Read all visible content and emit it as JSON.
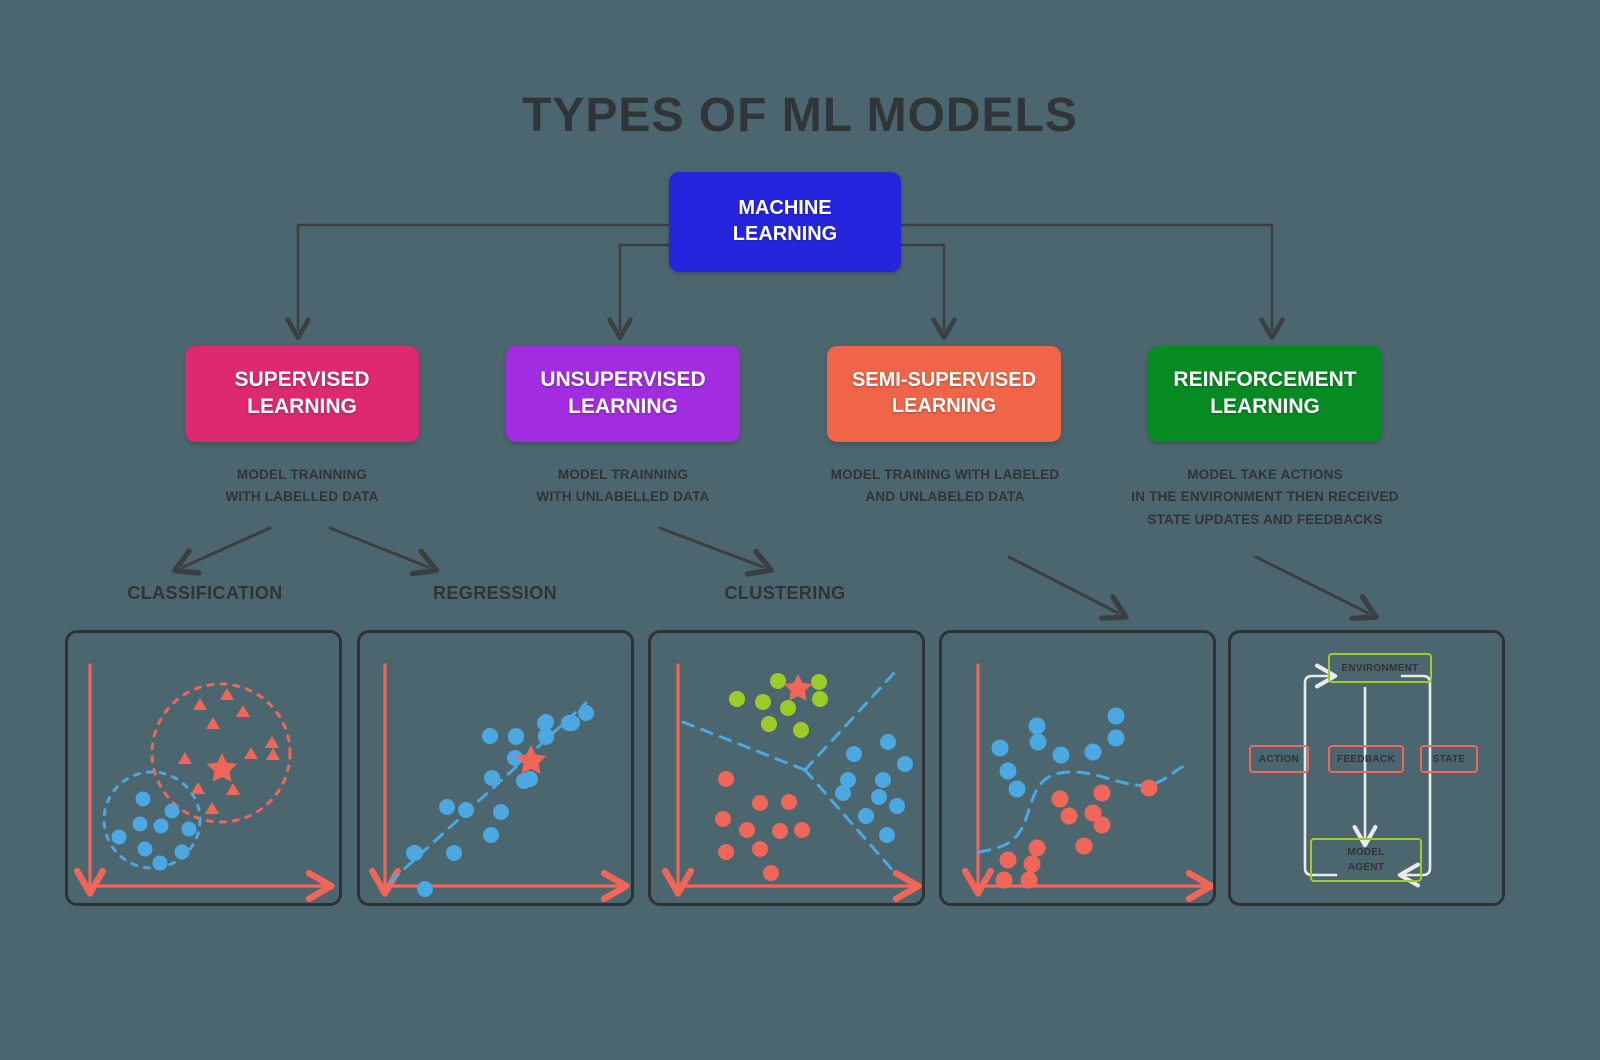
{
  "page": {
    "title": "TYPES OF ML MODELS",
    "background_color": "#4c6670",
    "text_color": "#2f3436"
  },
  "root_node": {
    "label": "MACHINE\nLEARNING",
    "line1": "MACHINE",
    "line2": "LEARNING",
    "color": "#2525dd"
  },
  "categories": [
    {
      "id": "supervised",
      "line1": "SUPERVISED",
      "line2": "LEARNING",
      "color": "#dc2970",
      "description_line1": "MODEL TRAINNING",
      "description_line2": "WITH LABELLED DATA"
    },
    {
      "id": "unsupervised",
      "line1": "UNSUPERVISED",
      "line2": "LEARNING",
      "color": "#a22ce0",
      "description_line1": "MODEL TRAINNING",
      "description_line2": "WITH UNLABELLED DATA"
    },
    {
      "id": "semi-supervised",
      "line1": "SEMI-SUPERVISED",
      "line2": "LEARNING",
      "color": "#f06548",
      "description_line1": "MODEL TRAINING WITH LABELED",
      "description_line2": "AND UNLABELED DATA"
    },
    {
      "id": "reinforcement",
      "line1": "REINFORCEMENT",
      "line2": "LEARNING",
      "color": "#068a22",
      "description_line1": "MODEL TAKE ACTIONS",
      "description_line2": "IN THE ENVIRONMENT THEN RECEIVED",
      "description_line3": "STATE UPDATES AND FEEDBACKS"
    }
  ],
  "sub_labels": {
    "classification": "CLASSIFICATION",
    "regression": "REGRESSION",
    "clustering": "CLUSTERING"
  },
  "rl_diagram": {
    "environment": "ENVIRONMENT",
    "action": "ACTION",
    "feedback": "FEEDBACK",
    "state": "STATE",
    "model_agent_line1": "MODEL",
    "model_agent_line2": "AGENT",
    "green_border": "#9ccb2a",
    "red_border": "#f0675a",
    "arrow_color": "#e8ebe9"
  },
  "palette": {
    "axis_red": "#f0675a",
    "point_blue": "#4ba8e0",
    "point_green": "#9ccb2a",
    "point_red": "#f0675a",
    "panel_border": "#2d3234",
    "connector": "#3a4042"
  },
  "chart_data": [
    {
      "id": "classification",
      "type": "scatter",
      "title": "CLASSIFICATION",
      "xlabel": "",
      "ylabel": "",
      "grid": false,
      "legend": "none",
      "xlim": [
        0,
        100
      ],
      "ylim": [
        0,
        100
      ],
      "series": [
        {
          "name": "class-a-triangles",
          "marker": "triangle",
          "color": "#f0675a",
          "points": [
            [
              57,
              78
            ],
            [
              47,
              71
            ],
            [
              61,
              68
            ],
            [
              54,
              63
            ],
            [
              72,
              64
            ],
            [
              72,
              58
            ],
            [
              78,
              61
            ],
            [
              42,
              57
            ],
            [
              48,
              45
            ],
            [
              59,
              45
            ],
            [
              52,
              38
            ],
            [
              55,
              53
            ]
          ]
        },
        {
          "name": "class-b-circles",
          "marker": "circle",
          "color": "#4ba8e0",
          "points": [
            [
              25,
              41
            ],
            [
              34,
              37
            ],
            [
              23,
              32
            ],
            [
              31,
              31
            ],
            [
              38,
              30
            ],
            [
              16,
              26
            ],
            [
              25,
              22
            ],
            [
              39,
              21
            ],
            [
              30,
              17
            ]
          ]
        },
        {
          "name": "query-point",
          "marker": "star",
          "color": "#f0675a",
          "points": [
            [
              55,
              53
            ]
          ]
        }
      ],
      "boundaries": [
        {
          "shape": "circle",
          "color": "#f0675a",
          "style": "dashed",
          "cx": 57,
          "cy": 56,
          "r": 24
        },
        {
          "shape": "circle",
          "color": "#4ba8e0",
          "style": "dashed",
          "cx": 27,
          "cy": 29,
          "r": 17
        }
      ]
    },
    {
      "id": "regression",
      "type": "scatter",
      "title": "REGRESSION",
      "xlabel": "",
      "ylabel": "",
      "grid": false,
      "legend": "none",
      "xlim": [
        0,
        100
      ],
      "ylim": [
        0,
        100
      ],
      "series": [
        {
          "name": "observations",
          "marker": "circle",
          "color": "#4ba8e0",
          "points": [
            [
              17,
              7
            ],
            [
              13,
              20
            ],
            [
              24,
              20
            ],
            [
              33,
              26
            ],
            [
              23,
              36
            ],
            [
              28,
              35
            ],
            [
              37,
              35
            ],
            [
              34,
              47
            ],
            [
              43,
              54
            ],
            [
              40,
              62
            ],
            [
              46,
              47
            ],
            [
              60,
              55
            ],
            [
              53,
              67
            ],
            [
              66,
              70
            ],
            [
              76,
              63
            ],
            [
              83,
              74
            ]
          ]
        },
        {
          "name": "prediction",
          "marker": "star",
          "color": "#f0675a",
          "points": [
            [
              64,
              60
            ]
          ]
        }
      ],
      "fit_line": {
        "style": "dashed",
        "color": "#4ba8e0",
        "from": [
          3,
          2
        ],
        "to": [
          80,
          80
        ]
      }
    },
    {
      "id": "clustering",
      "type": "scatter",
      "title": "CLUSTERING",
      "xlabel": "",
      "ylabel": "",
      "grid": false,
      "legend": "none",
      "xlim": [
        0,
        100
      ],
      "ylim": [
        0,
        100
      ],
      "series": [
        {
          "name": "cluster-green",
          "marker": "circle",
          "color": "#9ccb2a",
          "points": [
            [
              41,
              82
            ],
            [
              26,
              73
            ],
            [
              36,
              73
            ],
            [
              46,
              69
            ],
            [
              57,
              82
            ],
            [
              58,
              74
            ],
            [
              38,
              64
            ],
            [
              49,
              61
            ]
          ]
        },
        {
          "name": "cluster-red",
          "marker": "circle",
          "color": "#f0675a",
          "points": [
            [
              21,
              46
            ],
            [
              34,
              38
            ],
            [
              45,
              38
            ],
            [
              19,
              31
            ],
            [
              28,
              27
            ],
            [
              41,
              27
            ],
            [
              52,
              27
            ],
            [
              21,
              20
            ],
            [
              34,
              20
            ],
            [
              42,
              12
            ]
          ]
        },
        {
          "name": "cluster-blue",
          "marker": "circle",
          "color": "#4ba8e0",
          "points": [
            [
              71,
              55
            ],
            [
              88,
              58
            ],
            [
              64,
              45
            ],
            [
              62,
              41
            ],
            [
              97,
              50
            ],
            [
              81,
              47
            ],
            [
              93,
              37
            ],
            [
              73,
              33
            ],
            [
              88,
              28
            ],
            [
              71,
              27
            ]
          ]
        },
        {
          "name": "centroid-marker",
          "marker": "star",
          "color": "#f0675a",
          "points": [
            [
              48,
              81
            ]
          ]
        }
      ],
      "boundaries": [
        {
          "shape": "polyline",
          "color": "#4ba8e0",
          "style": "dashed",
          "points": [
            [
              2,
              65
            ],
            [
              55,
              48
            ]
          ]
        },
        {
          "shape": "polyline",
          "color": "#4ba8e0",
          "style": "dashed",
          "points": [
            [
              55,
              48
            ],
            [
              91,
              84
            ]
          ]
        },
        {
          "shape": "polyline",
          "color": "#4ba8e0",
          "style": "dashed",
          "points": [
            [
              55,
              48
            ],
            [
              86,
              2
            ]
          ]
        }
      ]
    },
    {
      "id": "semi-supervised",
      "type": "scatter",
      "title": "SEMI-SUPERVISED",
      "xlabel": "",
      "ylabel": "",
      "grid": false,
      "legend": "none",
      "xlim": [
        0,
        100
      ],
      "ylim": [
        0,
        100
      ],
      "series": [
        {
          "name": "labeled-blue",
          "marker": "circle",
          "color": "#4ba8e0",
          "points": [
            [
              12,
              60
            ],
            [
              27,
              66
            ],
            [
              27,
              58
            ],
            [
              18,
              50
            ],
            [
              21,
              44
            ],
            [
              42,
              55
            ],
            [
              58,
              56
            ],
            [
              66,
              69
            ],
            [
              66,
              60
            ]
          ]
        },
        {
          "name": "labeled-red",
          "marker": "circle",
          "color": "#f0675a",
          "points": [
            [
              45,
              40
            ],
            [
              51,
              33
            ],
            [
              61,
              39
            ],
            [
              59,
              31
            ],
            [
              62,
              27
            ],
            [
              85,
              43
            ],
            [
              55,
              18
            ],
            [
              31,
              20
            ],
            [
              22,
              15
            ],
            [
              34,
              13
            ],
            [
              18,
              8
            ],
            [
              31,
              8
            ]
          ]
        }
      ],
      "boundaries": [
        {
          "shape": "curve",
          "color": "#4ba8e0",
          "style": "dashed",
          "description": "sigmoid decision boundary separating blue above from red below"
        }
      ]
    },
    {
      "id": "reinforcement",
      "type": "diagram",
      "title": "REINFORCEMENT",
      "nodes": [
        "ENVIRONMENT",
        "ACTION",
        "FEEDBACK",
        "STATE",
        "MODEL AGENT"
      ],
      "edges": [
        {
          "from": "MODEL AGENT",
          "to": "ENVIRONMENT",
          "via": "ACTION"
        },
        {
          "from": "ENVIRONMENT",
          "to": "MODEL AGENT",
          "via": "FEEDBACK"
        },
        {
          "from": "ENVIRONMENT",
          "to": "MODEL AGENT",
          "via": "STATE"
        }
      ]
    }
  ]
}
